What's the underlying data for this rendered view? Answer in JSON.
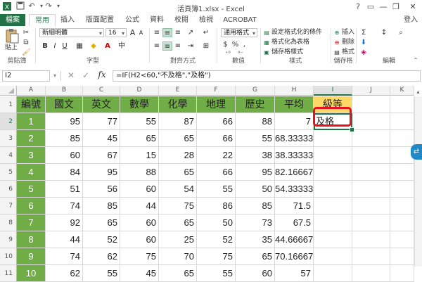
{
  "window": {
    "title": "活頁簿1.xlsx - Excel",
    "controls": [
      "?",
      "▭",
      "—",
      "❐",
      "✕"
    ]
  },
  "tabs": [
    {
      "label": "檔案"
    },
    {
      "label": "常用"
    },
    {
      "label": "插入"
    },
    {
      "label": "版面配置"
    },
    {
      "label": "公式"
    },
    {
      "label": "資料"
    },
    {
      "label": "校閱"
    },
    {
      "label": "檢視"
    },
    {
      "label": "ACROBAT"
    }
  ],
  "login_label": "登入",
  "ribbon": {
    "groups": [
      "剪貼簿",
      "字型",
      "對齊方式",
      "數值",
      "樣式",
      "儲存格",
      "編輯"
    ],
    "paste_label": "貼上",
    "font_name": "新細明體",
    "font_size": "16",
    "number_format": "通用格式",
    "style_items": [
      "設定格式化的條件",
      "格式化為表格",
      "儲存格樣式"
    ],
    "cell_items": [
      "插入",
      "刪除",
      "格式"
    ],
    "fmt_buttons": [
      "B",
      "I",
      "U"
    ],
    "num_buttons": [
      "$",
      "%",
      ","
    ]
  },
  "formula_bar": {
    "name_box": "I2",
    "formula": "=IF(H2<60,\"不及格\",\"及格\")"
  },
  "columns": [
    "A",
    "B",
    "C",
    "D",
    "E",
    "F",
    "G",
    "H",
    "I",
    "J",
    "K"
  ],
  "rows": [
    "1",
    "2",
    "3",
    "4",
    "5",
    "6",
    "7",
    "8",
    "9",
    "10",
    "11"
  ],
  "headers": [
    "編號",
    "國文",
    "英文",
    "數學",
    "化學",
    "地理",
    "歷史",
    "平均",
    "級等"
  ],
  "data": [
    [
      "1",
      "95",
      "77",
      "55",
      "87",
      "66",
      "88",
      "7",
      ""
    ],
    [
      "2",
      "85",
      "45",
      "65",
      "65",
      "66",
      "55",
      "68.33333",
      ""
    ],
    [
      "3",
      "60",
      "67",
      "15",
      "28",
      "22",
      "38",
      "38.33333",
      ""
    ],
    [
      "4",
      "84",
      "95",
      "88",
      "65",
      "66",
      "95",
      "82.16667",
      ""
    ],
    [
      "5",
      "51",
      "56",
      "60",
      "54",
      "55",
      "50",
      "54.33333",
      ""
    ],
    [
      "6",
      "74",
      "85",
      "44",
      "75",
      "86",
      "85",
      "71.5",
      ""
    ],
    [
      "7",
      "92",
      "65",
      "60",
      "65",
      "50",
      "73",
      "67.5",
      ""
    ],
    [
      "8",
      "44",
      "52",
      "60",
      "25",
      "52",
      "35",
      "44.66667",
      ""
    ],
    [
      "9",
      "74",
      "62",
      "75",
      "70",
      "75",
      "65",
      "70.16667",
      ""
    ],
    [
      "10",
      "62",
      "55",
      "45",
      "65",
      "55",
      "60",
      "57",
      ""
    ]
  ],
  "active_cell_value": "及格",
  "colors": {
    "excel_green": "#217346",
    "header_green": "#70ad47",
    "grade_yellow": "#ffd966",
    "highlight_red": "#e8121f"
  }
}
